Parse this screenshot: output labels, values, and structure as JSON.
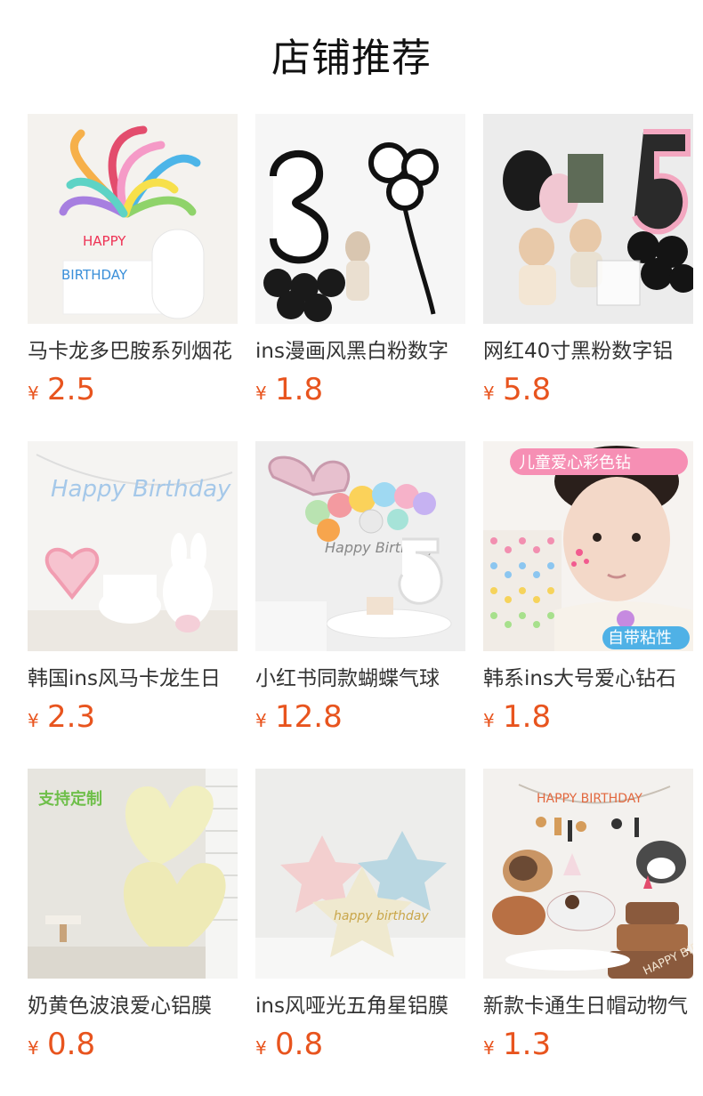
{
  "section": {
    "title": "店铺推荐"
  },
  "currency_symbol": "¥",
  "products": [
    {
      "name": "马卡龙多巴胺系列烟花",
      "price": "2.5",
      "image_icon": "rainbow-balloon-icon"
    },
    {
      "name": "ins漫画风黑白粉数字",
      "price": "1.8",
      "image_icon": "number-3-balloon-icon"
    },
    {
      "name": "网红40寸黑粉数字铝",
      "price": "5.8",
      "image_icon": "number-5-balloon-icon"
    },
    {
      "name": "韩国ins风马卡龙生日",
      "price": "2.3",
      "image_icon": "birthday-banner-icon"
    },
    {
      "name": "小红书同款蝴蝶气球",
      "price": "12.8",
      "image_icon": "bow-balloon-icon"
    },
    {
      "name": "韩系ins大号爱心钻石",
      "price": "1.8",
      "image_icon": "heart-gem-sticker-icon"
    },
    {
      "name": "奶黄色波浪爱心铝膜",
      "price": "0.8",
      "image_icon": "heart-balloon-icon"
    },
    {
      "name": "ins风哑光五角星铝膜",
      "price": "0.8",
      "image_icon": "star-balloon-icon"
    },
    {
      "name": "新款卡通生日帽动物气",
      "price": "1.3",
      "image_icon": "dog-balloon-icon"
    }
  ],
  "image_overlays": {
    "p1": [
      "HAPPY",
      "BIRTHDAY"
    ],
    "p4": [
      "Happy Birthday"
    ],
    "p5": [
      "Happy Birthday"
    ],
    "p6": [
      "儿童爱心彩色钻",
      "自带粘性"
    ],
    "p7": [
      "支持定制"
    ],
    "p8": [
      "happy birthday"
    ],
    "p9": [
      "HAPPY BIRTHDAY",
      "HAPPY BIRTHDAY"
    ]
  },
  "colors": {
    "price": "#e8541e",
    "title": "#111111",
    "name": "#333333"
  }
}
